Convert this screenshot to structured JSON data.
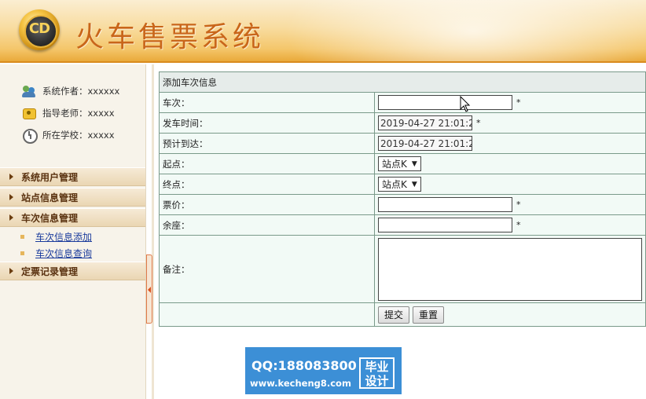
{
  "header": {
    "logo_text": "CD",
    "title": "火车售票系统"
  },
  "sidebar": {
    "info": [
      {
        "icon": "users-icon",
        "text": "系统作者：xxxxxx"
      },
      {
        "icon": "teacher-icon",
        "text": "指导老师：xxxxx"
      },
      {
        "icon": "clock-icon",
        "text": "所在学校：xxxxx"
      }
    ],
    "menu": [
      {
        "label": "系统用户管理"
      },
      {
        "label": "站点信息管理"
      },
      {
        "label": "车次信息管理",
        "children": [
          "车次信息添加",
          "车次信息查询"
        ]
      },
      {
        "label": "定票记录管理"
      }
    ]
  },
  "form": {
    "title": "添加车次信息",
    "fields": {
      "train_no": {
        "label": "车次：",
        "value": "",
        "required": "*"
      },
      "depart_time": {
        "label": "发车时间：",
        "value": "2019-04-27 21:01:2",
        "required": "*"
      },
      "arrive_time": {
        "label": "预计到达：",
        "value": "2019-04-27 21:01:2"
      },
      "start": {
        "label": "起点：",
        "selected": "站点K"
      },
      "end": {
        "label": "终点：",
        "selected": "站点K"
      },
      "price": {
        "label": "票价：",
        "value": "",
        "required": "*"
      },
      "seats": {
        "label": "余座：",
        "value": "",
        "required": "*"
      },
      "remark": {
        "label": "备注：",
        "value": ""
      }
    },
    "buttons": {
      "submit": "提交",
      "reset": "重置"
    }
  },
  "watermark": {
    "qq": "QQ:188083800",
    "url": "www.kecheng8.com",
    "badge_line1": "毕业",
    "badge_line2": "设计"
  },
  "colors": {
    "header_orange": "#f4c66a",
    "title_text": "#c9661a",
    "form_bg": "#f2faf6",
    "watermark_bg": "#3c8fd6"
  }
}
